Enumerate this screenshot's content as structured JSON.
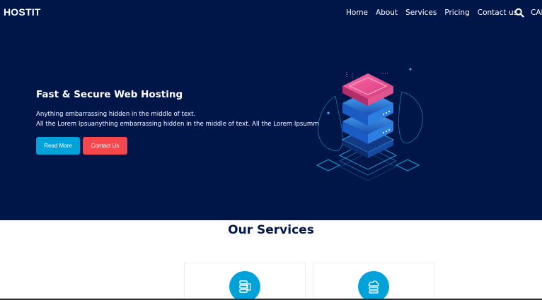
{
  "header": {
    "brand": "HOSTIT",
    "nav": [
      "Home",
      "About",
      "Services",
      "Pricing",
      "Contact us"
    ],
    "search_icon": "search-icon",
    "call_label": "CAL"
  },
  "hero": {
    "title": "Fast & Secure Web Hosting",
    "line1": "Anything embarrassing hidden in the middle of text.",
    "line2": "All the Lorem Ipsuanything embarrassing hidden in the middle of text. All the Lorem Ipsumm",
    "read_more": "Read More",
    "contact_us": "Contact Us",
    "illustration": "server-stack-illustration"
  },
  "services": {
    "title": "Our Services",
    "cards": [
      {
        "icon": "server-icon"
      },
      {
        "icon": "cloud-server-icon"
      }
    ]
  },
  "colors": {
    "hero_bg": "#001548",
    "accent_blue": "#00a2d9",
    "accent_red": "#f5474c",
    "white": "#ffffff"
  }
}
